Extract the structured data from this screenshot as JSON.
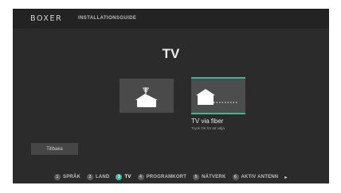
{
  "header": {
    "brand": "BOXER",
    "section": "INSTALLATIONSGUIDE"
  },
  "page": {
    "title": "TV"
  },
  "options": [
    {
      "icon": "antenna-house-icon",
      "selected": false
    },
    {
      "icon": "fiber-house-icon",
      "selected": true,
      "label": "TV via fiber",
      "hint": "Tryck OK för att välja"
    }
  ],
  "back_label": "Tillbaka",
  "steps": [
    {
      "num": "1",
      "label": "SPRÅK"
    },
    {
      "num": "2",
      "label": "LAND"
    },
    {
      "num": "3",
      "label": "TV",
      "active": true
    },
    {
      "num": "4",
      "label": "PROGRAMKORT"
    },
    {
      "num": "5",
      "label": "NÄTVERK"
    },
    {
      "num": "6",
      "label": "AKTIV ANTENN"
    }
  ],
  "next_icon": "chevron-right-icon",
  "colors": {
    "accent": "#46b394",
    "background": "#2b2b2c"
  }
}
